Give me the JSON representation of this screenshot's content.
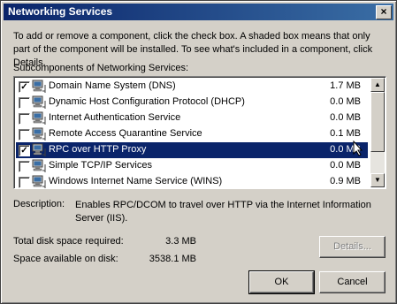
{
  "window": {
    "title": "Networking Services"
  },
  "intro": "To add or remove a component, click the check box. A shaded box means that only part of the component will be installed. To see what's included in a component, click Details.",
  "list_label": "Subcomponents of Networking Services:",
  "items": [
    {
      "label": "Domain Name System (DNS)",
      "size": "1.7 MB",
      "checked": true
    },
    {
      "label": "Dynamic Host Configuration Protocol (DHCP)",
      "size": "0.0 MB",
      "checked": false
    },
    {
      "label": "Internet Authentication Service",
      "size": "0.0 MB",
      "checked": false
    },
    {
      "label": "Remote Access Quarantine Service",
      "size": "0.1 MB",
      "checked": false
    },
    {
      "label": "RPC over HTTP Proxy",
      "size": "0.0 MB",
      "checked": true,
      "selected": true
    },
    {
      "label": "Simple TCP/IP Services",
      "size": "0.0 MB",
      "checked": false
    },
    {
      "label": "Windows Internet Name Service (WINS)",
      "size": "0.9 MB",
      "checked": false
    }
  ],
  "description_label": "Description:",
  "description": "Enables RPC/DCOM to travel over HTTP via the Internet Information Server (IIS).",
  "disk_required_label": "Total disk space required:",
  "disk_required": "3.3 MB",
  "disk_available_label": "Space available on disk:",
  "disk_available": "3538.1 MB",
  "buttons": {
    "details": "Details...",
    "ok": "OK",
    "cancel": "Cancel"
  },
  "icons": {
    "item": "network-component-icon",
    "check": "✓"
  }
}
